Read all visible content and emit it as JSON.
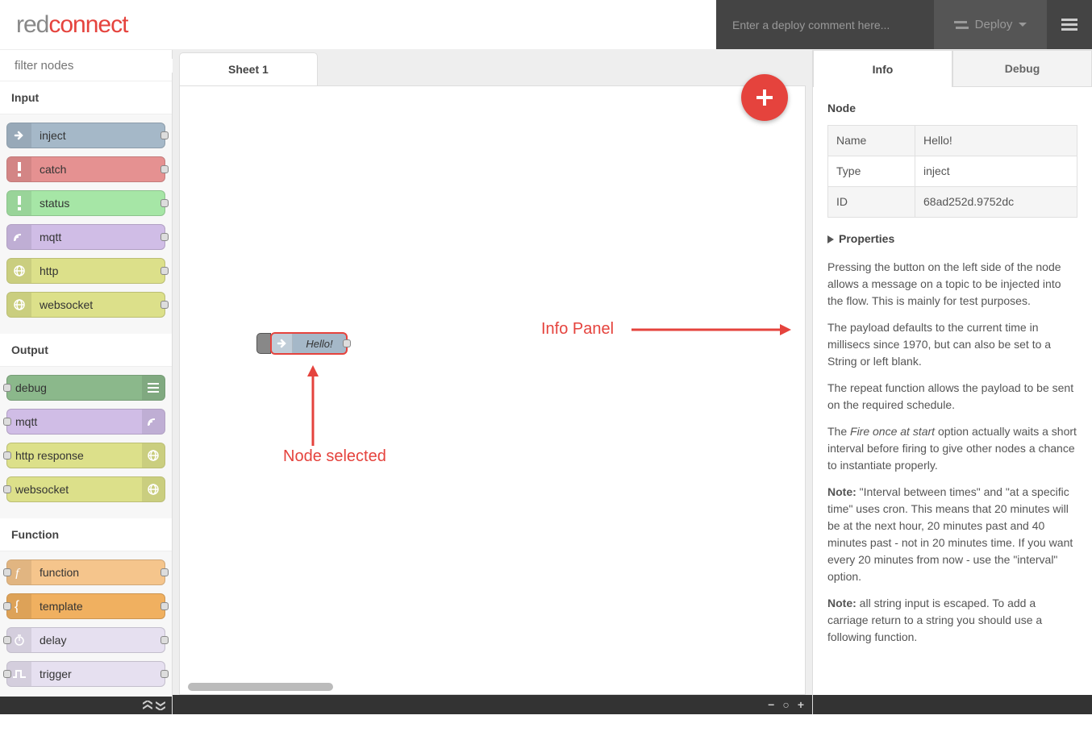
{
  "header": {
    "logo_left": "red",
    "logo_right": "connect",
    "deploy_placeholder": "Enter a deploy comment here...",
    "deploy_label": "Deploy"
  },
  "palette": {
    "filter_placeholder": "filter nodes",
    "categories": [
      {
        "name": "Input",
        "nodes": [
          {
            "label": "inject",
            "color": "#a5b8c8",
            "icon": "arrow-right",
            "port": "out"
          },
          {
            "label": "catch",
            "color": "#e59191",
            "icon": "exclaim",
            "port": "out"
          },
          {
            "label": "status",
            "color": "#a6e6a6",
            "icon": "exclaim",
            "port": "out"
          },
          {
            "label": "mqtt",
            "color": "#d0bde6",
            "icon": "wifi",
            "port": "out"
          },
          {
            "label": "http",
            "color": "#dce08a",
            "icon": "globe",
            "port": "out"
          },
          {
            "label": "websocket",
            "color": "#dce08a",
            "icon": "globe",
            "port": "out"
          }
        ]
      },
      {
        "name": "Output",
        "nodes": [
          {
            "label": "debug",
            "color": "#8bb88b",
            "icon": "list",
            "port": "in",
            "endicon": true
          },
          {
            "label": "mqtt",
            "color": "#d0bde6",
            "icon": "wifi",
            "port": "in",
            "endicon": true
          },
          {
            "label": "http response",
            "color": "#dce08a",
            "icon": "globe",
            "port": "in",
            "endicon": true
          },
          {
            "label": "websocket",
            "color": "#dce08a",
            "icon": "globe",
            "port": "in",
            "endicon": true
          }
        ]
      },
      {
        "name": "Function",
        "nodes": [
          {
            "label": "function",
            "color": "#f5c58c",
            "icon": "function",
            "port": "both"
          },
          {
            "label": "template",
            "color": "#f0b060",
            "icon": "brace",
            "port": "both"
          },
          {
            "label": "delay",
            "color": "#e6e0f0",
            "icon": "timer",
            "port": "both"
          },
          {
            "label": "trigger",
            "color": "#e6e0f0",
            "icon": "trigger",
            "port": "both"
          }
        ]
      }
    ]
  },
  "canvas": {
    "tab_label": "Sheet 1",
    "selected_node_label": "Hello!",
    "annotation_info_panel": "Info Panel",
    "annotation_node_selected": "Node selected"
  },
  "sidebar": {
    "tab_info": "Info",
    "tab_debug": "Debug",
    "section_node": "Node",
    "rows": {
      "name_label": "Name",
      "name_value": "Hello!",
      "type_label": "Type",
      "type_value": "inject",
      "id_label": "ID",
      "id_value": "68ad252d.9752dc"
    },
    "props_label": "Properties",
    "p1": "Pressing the button on the left side of the node allows a message on a topic to be injected into the flow. This is mainly for test purposes.",
    "p2": "The payload defaults to the current time in millisecs since 1970, but can also be set to a String or left blank.",
    "p3": "The repeat function allows the payload to be sent on the required schedule.",
    "p4_pre": "The ",
    "p4_em": "Fire once at start",
    "p4_post": " option actually waits a short interval before firing to give other nodes a chance to instantiate properly.",
    "p5_strong": "Note:",
    "p5_rest": " \"Interval between times\" and \"at a specific time\" uses cron. This means that 20 minutes will be at the next hour, 20 minutes past and 40 minutes past - not in 20 minutes time. If you want every 20 minutes from now - use the \"interval\" option.",
    "p6_strong": "Note:",
    "p6_rest": " all string input is escaped. To add a carriage return to a string you should use a following function."
  }
}
